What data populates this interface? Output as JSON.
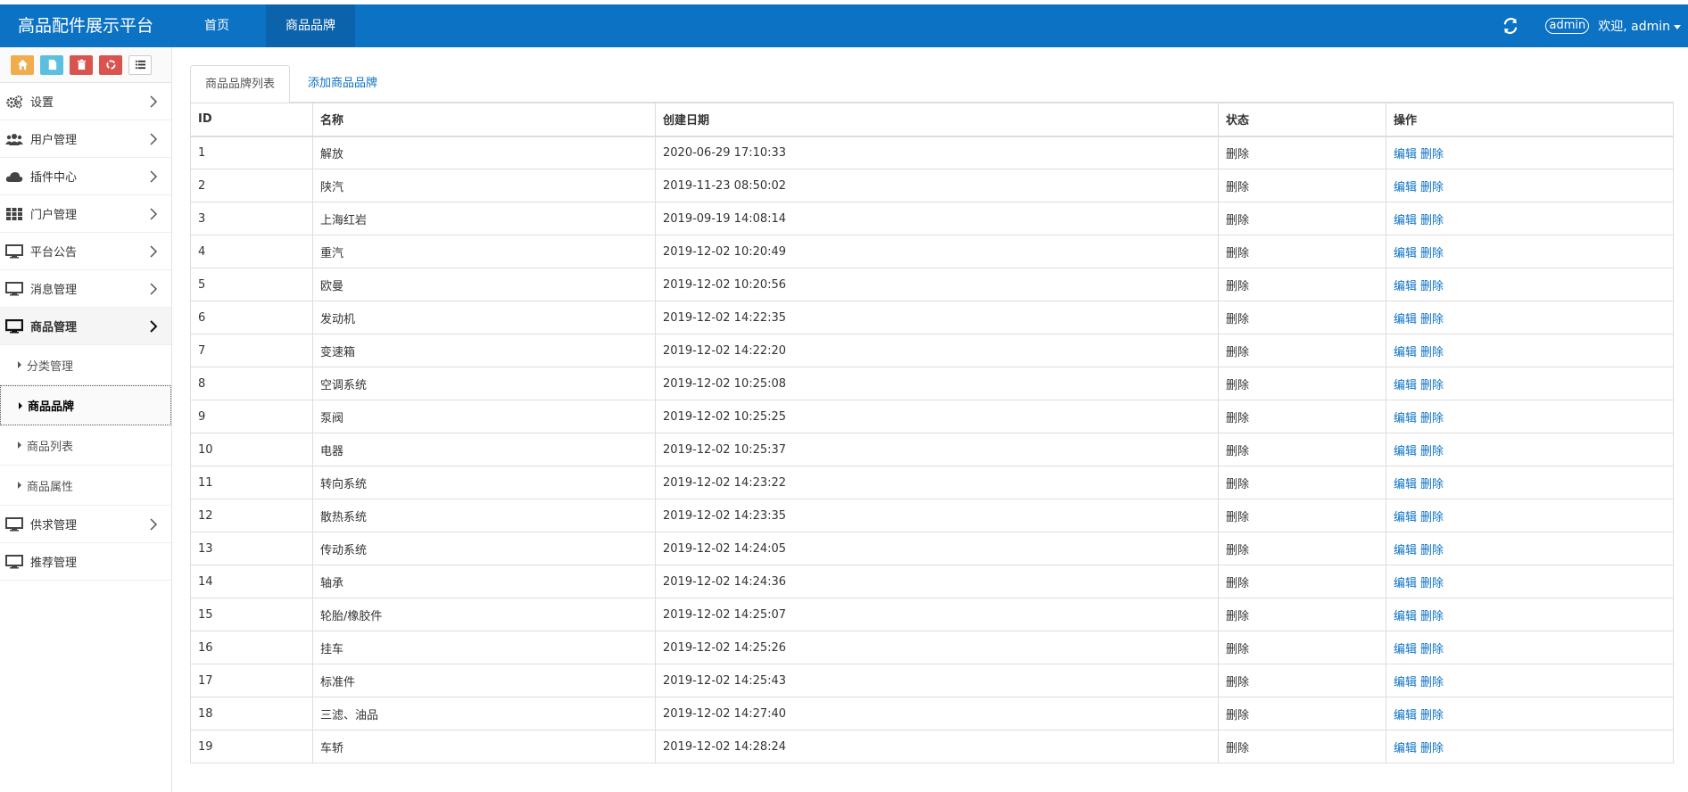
{
  "navbar": {
    "brand": "高品配件展示平台",
    "items": [
      "首页",
      "商品品牌"
    ],
    "admin_badge": "admin",
    "welcome": "欢迎, admin"
  },
  "sidebar": {
    "menu": [
      {
        "label": "设置",
        "icon": "gears-icon"
      },
      {
        "label": "用户管理",
        "icon": "users-icon"
      },
      {
        "label": "插件中心",
        "icon": "cloud-icon"
      },
      {
        "label": "门户管理",
        "icon": "grid-icon"
      },
      {
        "label": "平台公告",
        "icon": "desktop-icon"
      },
      {
        "label": "消息管理",
        "icon": "desktop-icon"
      },
      {
        "label": "商品管理",
        "icon": "desktop-icon"
      }
    ],
    "sub_items": [
      "分类管理",
      "商品品牌",
      "商品列表",
      "商品属性"
    ],
    "menu_after": [
      {
        "label": "供求管理",
        "icon": "desktop-icon"
      },
      {
        "label": "推荐管理",
        "icon": "desktop-icon"
      }
    ]
  },
  "tabs": [
    "商品品牌列表",
    "添加商品品牌"
  ],
  "table": {
    "headers": [
      "ID",
      "名称",
      "创建日期",
      "状态",
      "操作"
    ],
    "edit_label": "编辑",
    "delete_label": "删除",
    "rows": [
      {
        "id": "1",
        "name": "解放",
        "date": "2020-06-29 17:10:33",
        "status": "删除"
      },
      {
        "id": "2",
        "name": "陕汽",
        "date": "2019-11-23 08:50:02",
        "status": "删除"
      },
      {
        "id": "3",
        "name": "上海红岩",
        "date": "2019-09-19 14:08:14",
        "status": "删除"
      },
      {
        "id": "4",
        "name": "重汽",
        "date": "2019-12-02 10:20:49",
        "status": "删除"
      },
      {
        "id": "5",
        "name": "欧曼",
        "date": "2019-12-02 10:20:56",
        "status": "删除"
      },
      {
        "id": "6",
        "name": "发动机",
        "date": "2019-12-02 14:22:35",
        "status": "删除"
      },
      {
        "id": "7",
        "name": "变速箱",
        "date": "2019-12-02 14:22:20",
        "status": "删除"
      },
      {
        "id": "8",
        "name": "空调系统",
        "date": "2019-12-02 10:25:08",
        "status": "删除"
      },
      {
        "id": "9",
        "name": "泵阀",
        "date": "2019-12-02 10:25:25",
        "status": "删除"
      },
      {
        "id": "10",
        "name": "电器",
        "date": "2019-12-02 10:25:37",
        "status": "删除"
      },
      {
        "id": "11",
        "name": "转向系统",
        "date": "2019-12-02 14:23:22",
        "status": "删除"
      },
      {
        "id": "12",
        "name": "散热系统",
        "date": "2019-12-02 14:23:35",
        "status": "删除"
      },
      {
        "id": "13",
        "name": "传动系统",
        "date": "2019-12-02 14:24:05",
        "status": "删除"
      },
      {
        "id": "14",
        "name": "轴承",
        "date": "2019-12-02 14:24:36",
        "status": "删除"
      },
      {
        "id": "15",
        "name": "轮胎/橡胶件",
        "date": "2019-12-02 14:25:07",
        "status": "删除"
      },
      {
        "id": "16",
        "name": "挂车",
        "date": "2019-12-02 14:25:26",
        "status": "删除"
      },
      {
        "id": "17",
        "name": "标准件",
        "date": "2019-12-02 14:25:43",
        "status": "删除"
      },
      {
        "id": "18",
        "name": "三滤、油品",
        "date": "2019-12-02 14:27:40",
        "status": "删除"
      },
      {
        "id": "19",
        "name": "车轿",
        "date": "2019-12-02 14:28:24",
        "status": "删除"
      }
    ]
  },
  "colors": {
    "primary": "#0c72c4",
    "active_nav": "#0a63ab"
  }
}
